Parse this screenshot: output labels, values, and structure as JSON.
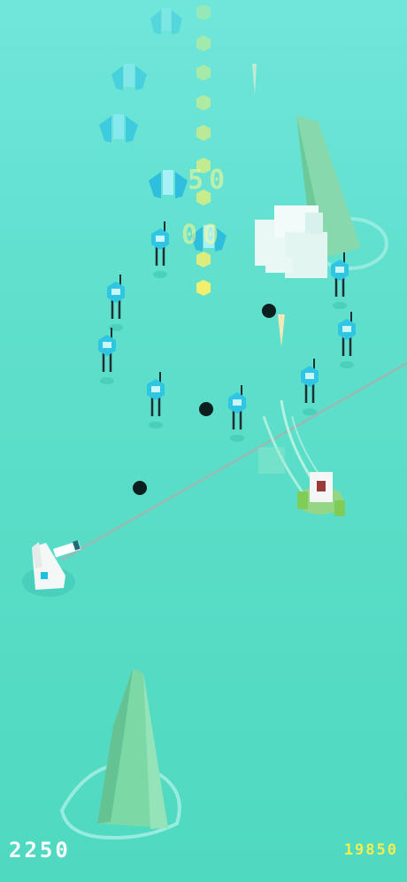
{
  "hud": {
    "score": "2250",
    "best_score": "19850"
  },
  "popups": {
    "points_a": "50",
    "points_b": "00"
  },
  "colors": {
    "sea": "#5fdfcc",
    "enemy": "#2ec6e3",
    "coin": "#f2ef6e",
    "crystal": "#7cd9a6",
    "bomb": "#0a1a1a",
    "laser": "#9ab9b2"
  },
  "icons": [
    "player-turret-icon",
    "player-ship-icon",
    "enemy-drone-icon",
    "enemy-fighter-icon",
    "coin-icon",
    "bomb-icon",
    "crystal-spire-icon",
    "explosion-icon",
    "missile-icon"
  ]
}
